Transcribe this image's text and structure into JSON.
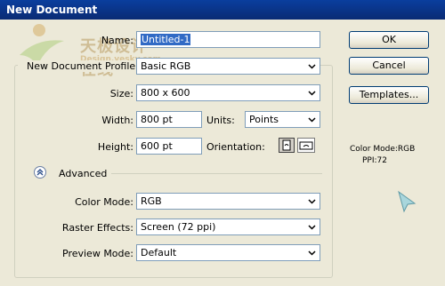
{
  "window": {
    "title": "New Document"
  },
  "watermark": {
    "text": "天极设计在线",
    "sub": "Design.yesky.com"
  },
  "fields": {
    "name": {
      "label": "Name:",
      "value": "Untitled-1"
    },
    "profile": {
      "label": "New Document Profile:",
      "value": "Basic RGB"
    },
    "size": {
      "label": "Size:",
      "value": "800 x 600"
    },
    "width": {
      "label": "Width:",
      "value": "800 pt"
    },
    "units": {
      "label": "Units:",
      "value": "Points"
    },
    "height": {
      "label": "Height:",
      "value": "600 pt"
    },
    "orientation": {
      "label": "Orientation:"
    }
  },
  "advanced": {
    "label": "Advanced",
    "color_mode": {
      "label": "Color Mode:",
      "value": "RGB"
    },
    "raster_effects": {
      "label": "Raster Effects:",
      "value": "Screen (72 ppi)"
    },
    "preview_mode": {
      "label": "Preview Mode:",
      "value": "Default"
    }
  },
  "buttons": {
    "ok": "OK",
    "cancel": "Cancel",
    "templates": "Templates..."
  },
  "info": {
    "color_mode": "Color Mode:RGB",
    "ppi": "PPI:72"
  },
  "icons": {
    "dropdown": "chevron-down-icon",
    "advanced": "double-chevron-up-icon",
    "portrait": "portrait-icon",
    "landscape": "landscape-icon",
    "cursor": "pointer-cursor-icon"
  }
}
